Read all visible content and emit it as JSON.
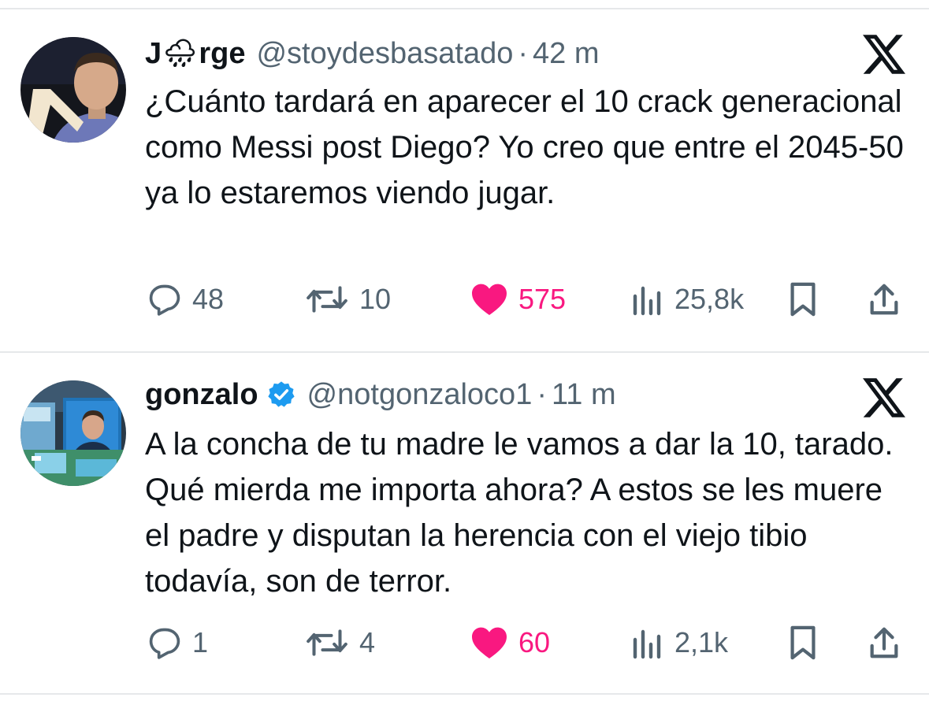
{
  "colors": {
    "text": "#0f1419",
    "secondary": "#536471",
    "like": "#f91880",
    "verified": "#1d9bf0",
    "divider": "#e6e8ea"
  },
  "tweets": [
    {
      "name_prefix": "J",
      "name_emoji": "🌧",
      "name_suffix": "rge",
      "handle": "@stoydesbasatado",
      "separator": "·",
      "time": "42 m",
      "verified": false,
      "text": "¿Cuánto tardará en aparecer el 10 crack generacional como Messi post Diego? Yo creo que entre el 2045-50 ya lo estaremos viendo jugar.",
      "replies": "48",
      "retweets": "10",
      "likes": "575",
      "views": "25,8k",
      "liked": true
    },
    {
      "name": "gonzalo",
      "handle": "@notgonzaloco1",
      "separator": "·",
      "time": "11 m",
      "verified": true,
      "text": "A la concha de tu madre le vamos a dar la 10, tarado. Qué mierda me importa ahora? A estos se les muere el padre y disputan la herencia con el viejo tibio todavía, son de terror.",
      "replies": "1",
      "retweets": "4",
      "likes": "60",
      "views": "2,1k",
      "liked": true
    }
  ],
  "icons": {
    "platform": "x-logo-icon",
    "reply": "speech-bubble-icon",
    "retweet": "retweet-arrows-icon",
    "like": "heart-icon",
    "views": "bar-chart-icon",
    "bookmark": "bookmark-icon",
    "share": "share-upload-icon"
  }
}
